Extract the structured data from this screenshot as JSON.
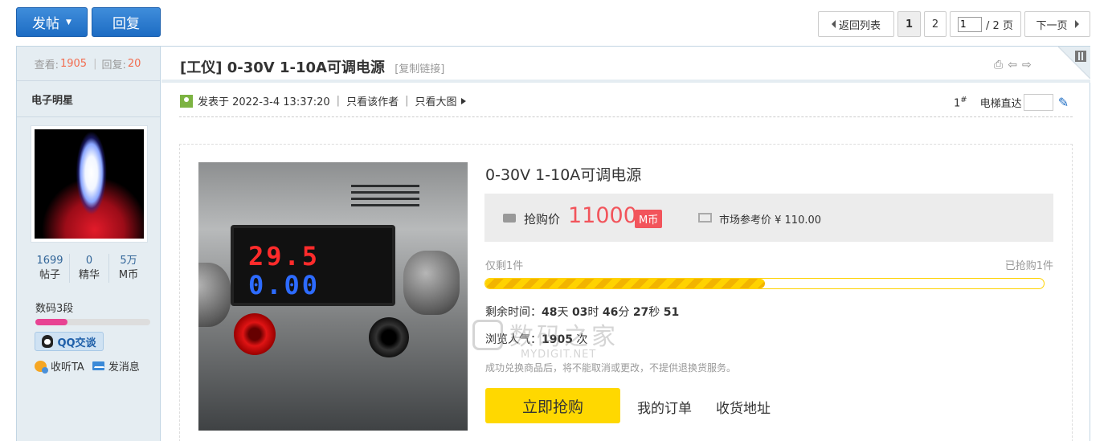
{
  "toolbar": {
    "post_label": "发帖",
    "reply_label": "回复"
  },
  "pager": {
    "back_label": "返回列表",
    "pages": [
      "1",
      "2"
    ],
    "current_page": "1",
    "total": "/ 2 页",
    "next_label": "下一页"
  },
  "sidebar": {
    "views_label": "查看:",
    "views": "1905",
    "replies_label": "回复:",
    "replies": "20",
    "author": "电子明星",
    "counts": [
      {
        "value": "1699",
        "label": "帖子"
      },
      {
        "value": "0",
        "label": "精华"
      },
      {
        "value": "5万",
        "label": "M币"
      }
    ],
    "level": "数码3段",
    "level_progress": 0.28,
    "qq_label": "QQ交谈",
    "follow_label": "收听TA",
    "message_label": "发消息"
  },
  "thread": {
    "title": "[工仪] 0-30V 1-10A可调电源",
    "copy_link": "[复制链接]",
    "posted": "发表于 2022-3-4 13:37:20",
    "only_author": "只看该作者",
    "big_image": "只看大图",
    "floor": "1",
    "floor_mark": "#",
    "elevator": "电梯直达"
  },
  "product": {
    "name": "0-30V 1-10A可调电源",
    "display_volts": "29.5",
    "display_amps": "0.00",
    "price_label": "抢购价",
    "price": "11000",
    "unit": "M币",
    "market_label": "市场参考价 ¥ 110.00",
    "left": "仅剩1件",
    "sold": "已抢购1件",
    "progress": 0.5,
    "countdown_label": "剩余时间：",
    "days": "48",
    "hours": "03",
    "minutes": "46",
    "seconds": "27",
    "tick": "51",
    "views_label": "浏览人气：",
    "views": "1905",
    "views_unit": "次",
    "notice": "成功兑换商品后，将不能取消或更改，不提供退换货服务。",
    "buy_label": "立即抢购",
    "orders_label": "我的订单",
    "address_label": "收货地址"
  },
  "watermark": {
    "text": "数码之家",
    "url": "MYDIGIT.NET"
  }
}
